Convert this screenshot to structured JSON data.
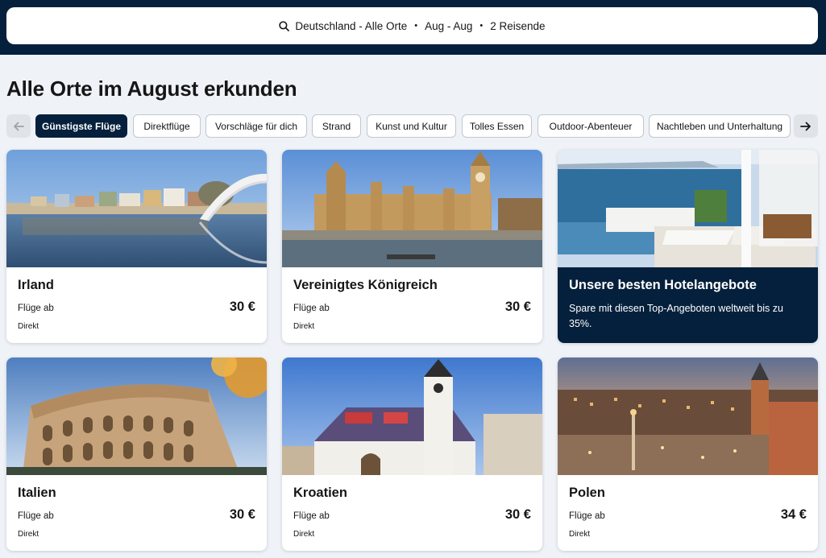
{
  "search": {
    "destination": "Deutschland - Alle Orte",
    "dates": "Aug - Aug",
    "travellers": "2 Reisende",
    "separator": "•"
  },
  "page_title": "Alle Orte im August erkunden",
  "filters": {
    "prev_icon": "arrow-left-icon",
    "next_icon": "arrow-right-icon",
    "chips": [
      "Günstigste Flüge",
      "Direktflüge",
      "Vorschläge für dich",
      "Strand",
      "Kunst und Kultur",
      "Tolles Essen",
      "Outdoor-Abenteuer",
      "Nachtleben und Unterhaltung"
    ],
    "active_chip": "Günstigste Flüge"
  },
  "cards": [
    {
      "title": "Irland",
      "sub": "Flüge ab",
      "price": "30 €",
      "direct": "Direkt"
    },
    {
      "title": "Vereinigtes Königreich",
      "sub": "Flüge ab",
      "price": "30 €",
      "direct": "Direkt"
    },
    {
      "title": "Unsere besten Hotelangebote",
      "desc": "Spare mit diesen Top-Angeboten weltweit bis zu 35%."
    },
    {
      "title": "Italien",
      "sub": "Flüge ab",
      "price": "30 €",
      "direct": "Direkt"
    },
    {
      "title": "Kroatien",
      "sub": "Flüge ab",
      "price": "30 €",
      "direct": "Direkt"
    },
    {
      "title": "Polen",
      "sub": "Flüge ab",
      "price": "34 €",
      "direct": "Direkt"
    }
  ],
  "colors": {
    "navy": "#05203c",
    "background": "#eff3f8",
    "text": "#161616"
  }
}
